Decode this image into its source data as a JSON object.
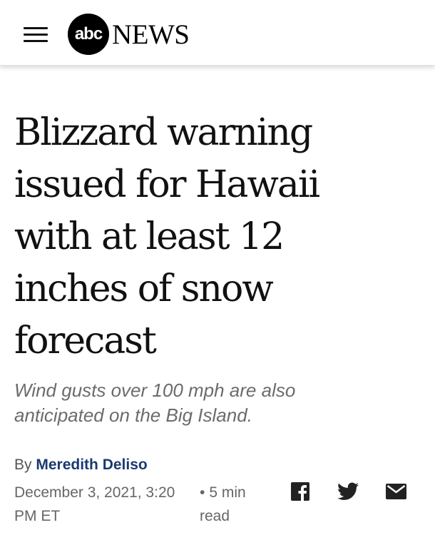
{
  "header": {
    "logo_abc": "abc",
    "logo_news": "NEWS"
  },
  "article": {
    "headline_lines": [
      "Blizzard warning",
      "issued for Hawaii",
      "with at least 12",
      "inches of snow",
      "forecast"
    ],
    "subhead_lines": [
      "Wind gusts over 100 mph are also",
      "anticipated on the Big Island."
    ],
    "byline_prefix": "By",
    "author": "Meredith Deliso",
    "date_line1": "December 3, 2021, 3:20",
    "date_line2": "PM ET",
    "read_dot": "•",
    "read_line1": "5 min",
    "read_line2": "read"
  },
  "share": {
    "icons": [
      "facebook-icon",
      "twitter-icon",
      "mail-icon"
    ]
  }
}
